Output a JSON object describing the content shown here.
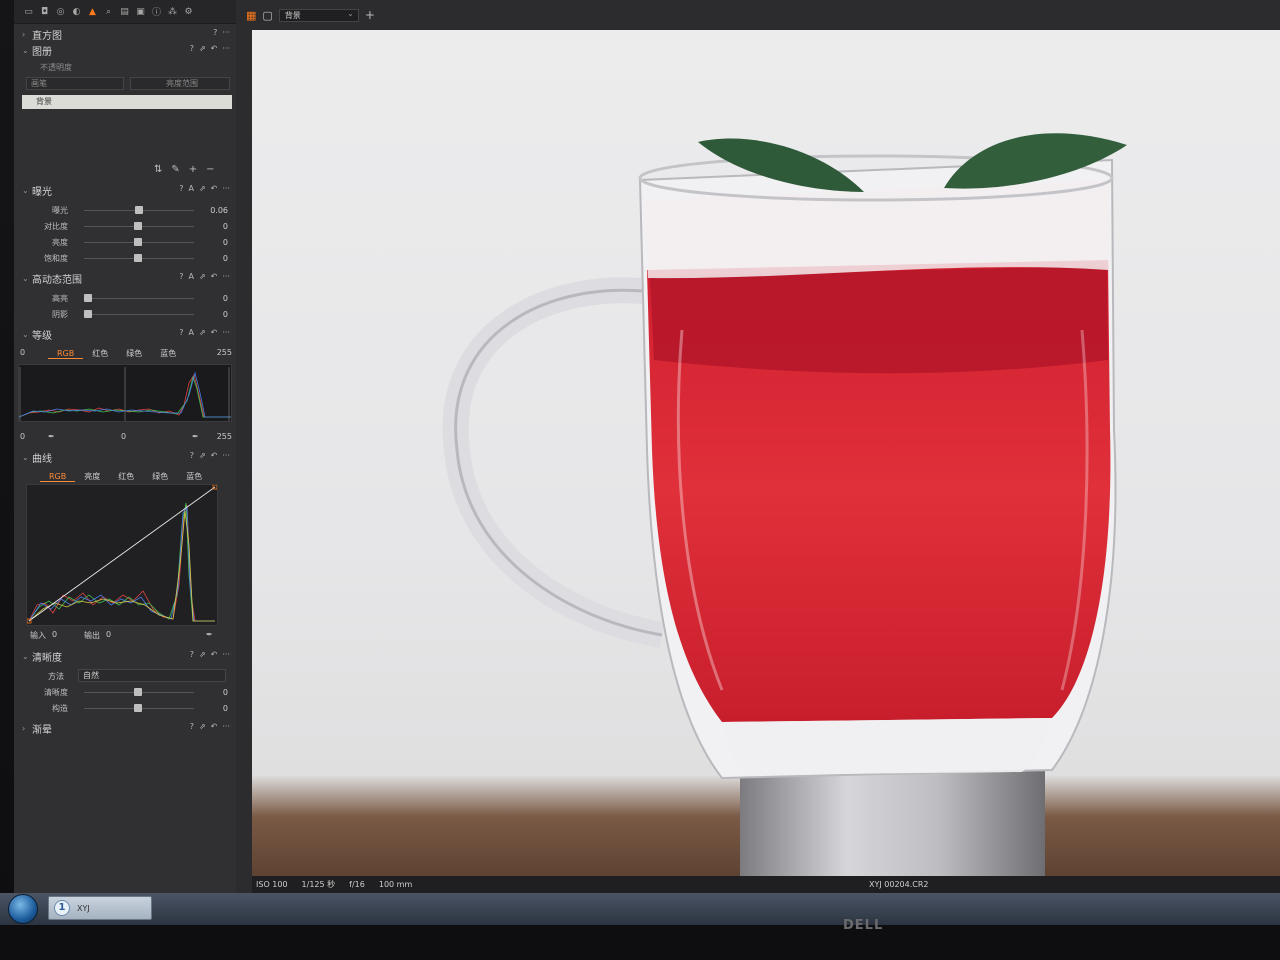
{
  "panel": {
    "sections": {
      "histogram": "直方图",
      "layers": "图册",
      "exposure": "曝光",
      "hdr": "高动态范围",
      "levels": "等级",
      "curves": "曲线",
      "clarity": "清晰度",
      "vignette": "渐晕"
    },
    "layers": {
      "opacity_label": "不透明度",
      "brush_label": "画笔",
      "range_button": "亮度范围",
      "layer_name": "背景"
    },
    "exposure": [
      {
        "label": "曝光",
        "value": "0.06",
        "pos": 0.49
      },
      {
        "label": "对比度",
        "value": "0",
        "pos": 0.48
      },
      {
        "label": "亮度",
        "value": "0",
        "pos": 0.48
      },
      {
        "label": "饱和度",
        "value": "0",
        "pos": 0.48
      }
    ],
    "hdr": [
      {
        "label": "高亮",
        "value": "0",
        "pos": 0.0
      },
      {
        "label": "阴影",
        "value": "0",
        "pos": 0.0
      }
    ],
    "levels": {
      "min": "0",
      "max": "255",
      "channels": [
        "RGB",
        "红色",
        "绿色",
        "蓝色"
      ],
      "in_low": "0",
      "in_mid": "0",
      "in_high": "255"
    },
    "curves": {
      "channels": [
        "RGB",
        "亮度",
        "红色",
        "绿色",
        "蓝色"
      ],
      "input_label": "输入",
      "input_value": "0",
      "output_label": "输出",
      "output_value": "0"
    },
    "clarity": {
      "method_label": "方法",
      "method_value": "自然",
      "rows": [
        {
          "label": "清晰度",
          "value": "0",
          "pos": 0.48
        },
        {
          "label": "构造",
          "value": "0",
          "pos": 0.48
        }
      ]
    }
  },
  "viewer": {
    "layer_select": "背景",
    "info": {
      "iso": "ISO 100",
      "shutter": "1/125 秒",
      "aperture": "f/16",
      "focal": "100 mm",
      "filename": "XYJ 00204.CR2"
    }
  },
  "taskbar": {
    "app_label": "XYJ"
  },
  "monitor_brand": "DELL",
  "colors": {
    "accent": "#ff7a1a",
    "drink": "#d8222e"
  }
}
